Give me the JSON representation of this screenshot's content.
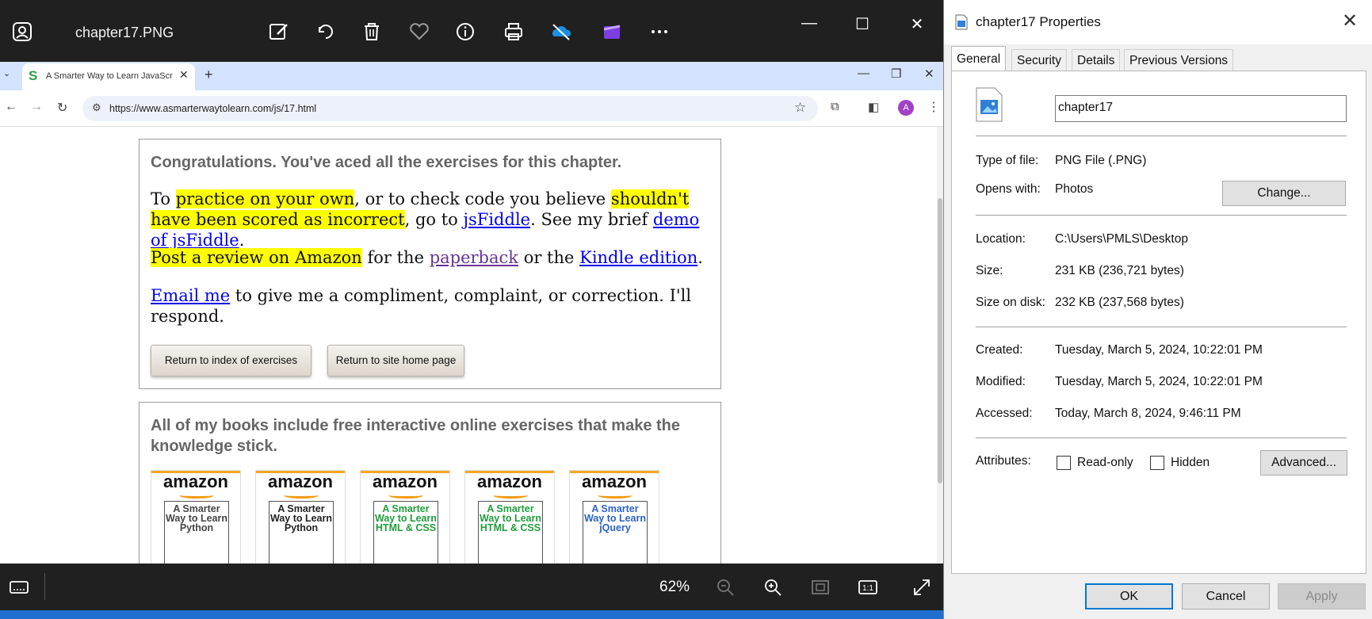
{
  "photos": {
    "file_name": "chapter17.PNG",
    "zoom": "62%",
    "toolbar_icons": [
      "edit-image-icon",
      "rotate-icon",
      "delete-icon",
      "favorite-icon",
      "info-icon",
      "print-icon",
      "onedrive-icon",
      "clipchamp-icon",
      "more-icon"
    ]
  },
  "browser": {
    "tab_title": "A Smarter Way to Learn JavaScript",
    "tab_favicon": "S",
    "url": "https://www.asmarterwaytolearn.com/js/17.html",
    "profile_initial": "A",
    "page": {
      "congrats": "Congratulations. You've aced all the exercises for this chapter.",
      "p1": {
        "t1": "To ",
        "h1": "practice on your own",
        "t2": ", or to check code you believe ",
        "h2": "shouldn't have been scored as incorrect",
        "t3": ", go to ",
        "l1": "jsFiddle",
        "t4": ". See my brief ",
        "l2": "demo of jsFiddle",
        "t5": "."
      },
      "p2": {
        "h1": "Post a review on Amazon",
        "t1": " for the ",
        "l1": "paperback",
        "t2": " or the ",
        "l2": "Kindle edition",
        "t3": "."
      },
      "p3": {
        "l1": "Email me",
        "t1": " to give me a compliment, complaint, or correction. I'll respond."
      },
      "btn_index": "Return to index of exercises",
      "btn_home": "Return to site home page",
      "books_heading": "All of my books include free interactive online exercises that make the knowledge stick.",
      "books": [
        {
          "brand": "amazon",
          "title": "A Smarter Way to Learn Python",
          "color": "#444444"
        },
        {
          "brand": "amazon",
          "title": "A Smarter Way to Learn Python",
          "color": "#222222"
        },
        {
          "brand": "amazon",
          "title": "A Smarter Way to Learn HTML & CSS",
          "color": "#1e9e3a"
        },
        {
          "brand": "amazon",
          "title": "A Smarter Way to Learn HTML & CSS",
          "color": "#1e9e3a"
        },
        {
          "brand": "amazon",
          "title": "A Smarter Way to Learn jQuery",
          "color": "#2b62c9"
        }
      ]
    }
  },
  "properties": {
    "title": "chapter17 Properties",
    "tabs": [
      "General",
      "Security",
      "Details",
      "Previous Versions"
    ],
    "file_name": "chapter17",
    "type_label": "Type of file:",
    "type_value": "PNG File (.PNG)",
    "opens_label": "Opens with:",
    "opens_value": "Photos",
    "change_button": "Change...",
    "location_label": "Location:",
    "location_value": "C:\\Users\\PMLS\\Desktop",
    "size_label": "Size:",
    "size_value": "231 KB (236,721 bytes)",
    "size_disk_label": "Size on disk:",
    "size_disk_value": "232 KB (237,568 bytes)",
    "created_label": "Created:",
    "created_value": "Tuesday, March 5, 2024, 10:22:01 PM",
    "modified_label": "Modified:",
    "modified_value": "Tuesday, March 5, 2024, 10:22:01 PM",
    "accessed_label": "Accessed:",
    "accessed_value": "Today, March 8, 2024, 9:46:11 PM",
    "attributes_label": "Attributes:",
    "readonly_label": "Read-only",
    "hidden_label": "Hidden",
    "advanced_button": "Advanced...",
    "ok_button": "OK",
    "cancel_button": "Cancel",
    "apply_button": "Apply"
  },
  "colors": {
    "highlight": "#ffff00",
    "link": "#0000ee",
    "visited_link": "#663399",
    "accent": "#0078d4"
  }
}
